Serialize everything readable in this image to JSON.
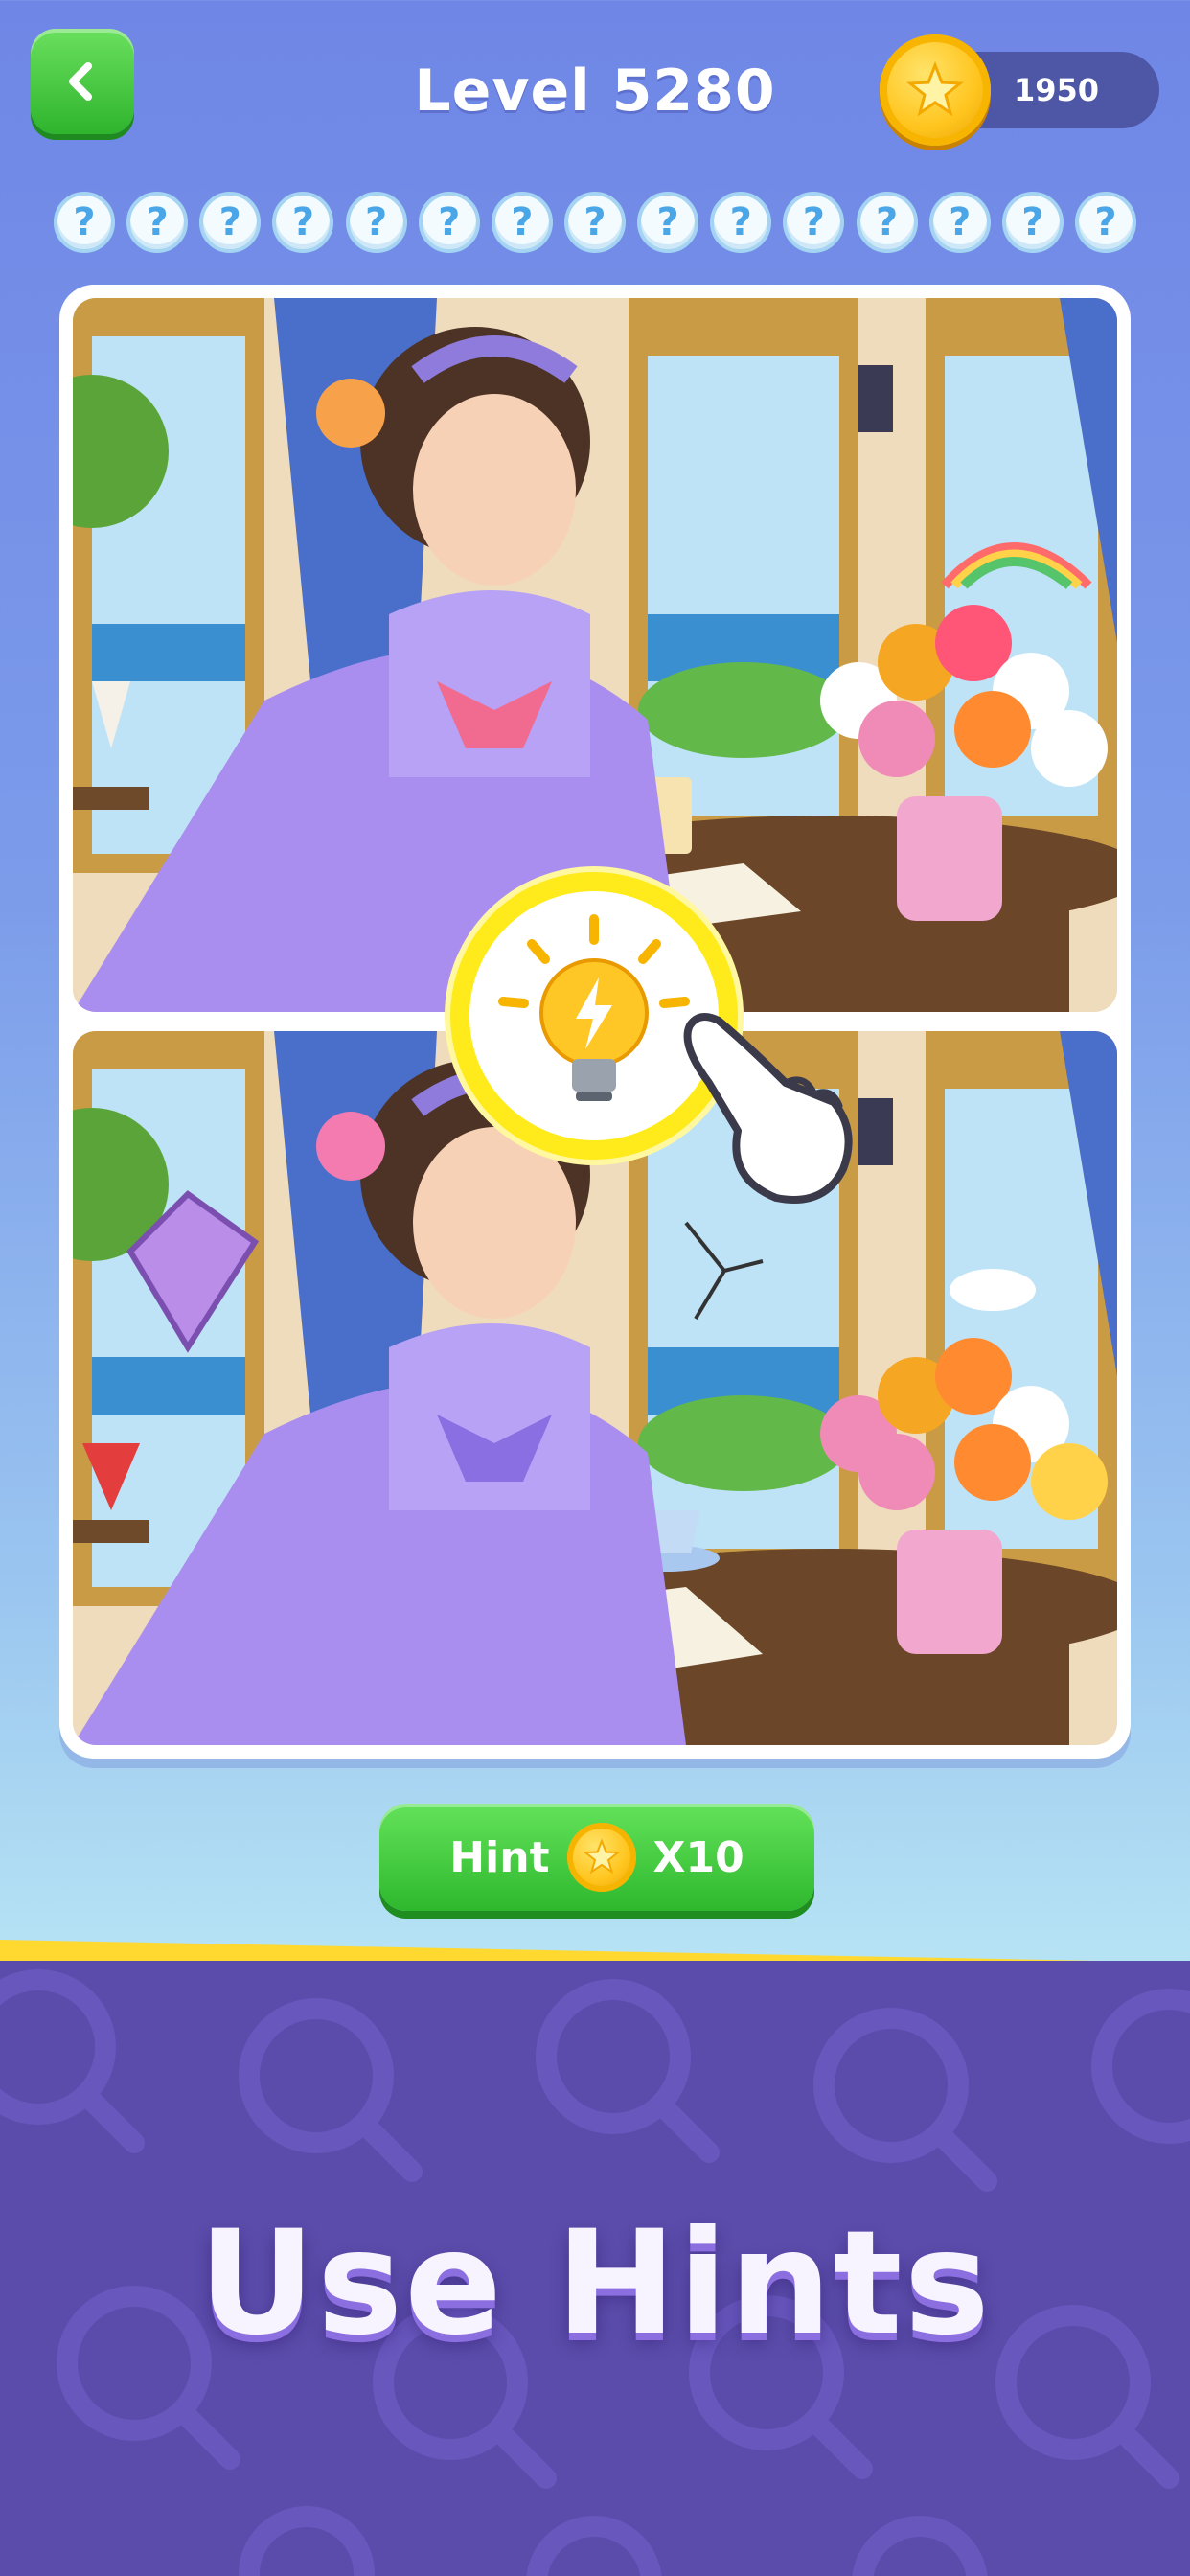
{
  "header": {
    "level_title": "Level 5280",
    "coins": "1950"
  },
  "markers": [
    "?",
    "?",
    "?",
    "?",
    "?",
    "?",
    "?",
    "?",
    "?",
    "?",
    "?",
    "?",
    "?",
    "?",
    "?"
  ],
  "hint_button": {
    "label": "Hint",
    "cost": "X10"
  },
  "promo": {
    "title": "Use Hints"
  },
  "colors": {
    "accent_green": "#2eb82d",
    "coin_gold": "#ffc51e",
    "promo_purple": "#5b4cab",
    "stripe_yellow": "#ffd930"
  },
  "icons": [
    "back-arrow-icon",
    "star-coin-icon",
    "question-mark-icon",
    "lightbulb-icon",
    "pointer-hand-icon"
  ]
}
